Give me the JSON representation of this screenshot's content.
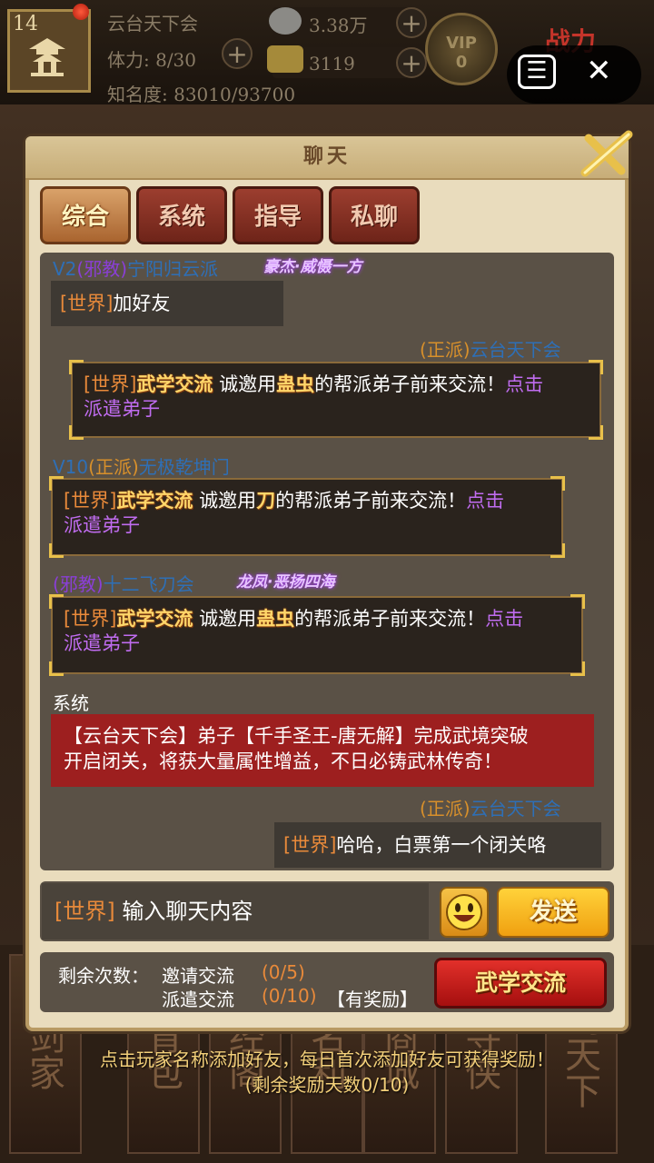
{
  "topbar": {
    "level": "14",
    "guild_name": "云台天下会",
    "stamina": "体力: 8/30",
    "fame": "知名度: 83010/93700",
    "silver": "3.38万",
    "gold": "3119",
    "vip_label": "VIP",
    "vip_level": "0",
    "power_label": "战力"
  },
  "modal": {
    "title": "聊天",
    "tabs": [
      {
        "label": "综合",
        "active": true
      },
      {
        "label": "系统",
        "active": false
      },
      {
        "label": "指导",
        "active": false
      },
      {
        "label": "私聊",
        "active": false
      }
    ]
  },
  "messages": [
    {
      "vip": "V2",
      "faction": "(邪教)",
      "name": "宁阳归云派",
      "badge": "豪杰·威慑一方",
      "channel": "[世界]",
      "text": "加好友"
    },
    {
      "faction": "(正派)",
      "name": "云台天下会",
      "channel": "[世界]",
      "event": "武学交流",
      "pre": "诚邀用",
      "item": "蛊虫",
      "post": "的帮派弟子前来交流！",
      "link1": "点击",
      "link2": "派遣弟子"
    },
    {
      "vip": "V10",
      "faction": "(正派)",
      "name": "无极乾坤门",
      "channel": "[世界]",
      "event": "武学交流",
      "pre": "诚邀用",
      "item": "刀",
      "post": "的帮派弟子前来交流！",
      "link1": "点击",
      "link2": "派遣弟子"
    },
    {
      "faction": "(邪教)",
      "name": "十二飞刀会",
      "badge": "龙凤·恶扬四海",
      "channel": "[世界]",
      "event": "武学交流",
      "pre": "诚邀用",
      "item": "蛊虫",
      "post": "的帮派弟子前来交流！",
      "link1": "点击",
      "link2": "派遣弟子"
    },
    {
      "sender": "系统",
      "line1": "【云台天下会】弟子【千手圣王-唐无解】完成武境突破",
      "line2": "开启闭关，将获大量属性增益，不日必铸武林传奇！"
    },
    {
      "faction": "(正派)",
      "name": "云台天下会",
      "channel": "[世界]",
      "text": "哈哈，白票第一个闭关咯"
    }
  ],
  "input": {
    "channel": "[世界]",
    "placeholder": "输入聊天内容",
    "send_label": "发送"
  },
  "info": {
    "remaining_label": "剩余次数：",
    "invite_label": "邀请交流",
    "invite_count": "(0/5)",
    "dispatch_label": "派遣交流",
    "dispatch_count": "(0/10)",
    "reward_label": "【有奖励】",
    "exchange_button": "武学交流"
  },
  "footer": {
    "line1": "点击玩家名称添加好友，每日首次添加好友可获得奖励！",
    "line2": "(剩余奖励天数0/10)"
  },
  "bottom_nav": [
    "剑家",
    "背包",
    "经阁",
    "名利",
    "商城",
    "寻侠",
    "剑天下"
  ],
  "colors": {
    "world_channel": "#e98a3a",
    "evil": "#8a3fd6",
    "good": "#d8902b",
    "name": "#2e6fb6",
    "link": "#c06cf0",
    "system_bg": "#9d1f1f"
  }
}
